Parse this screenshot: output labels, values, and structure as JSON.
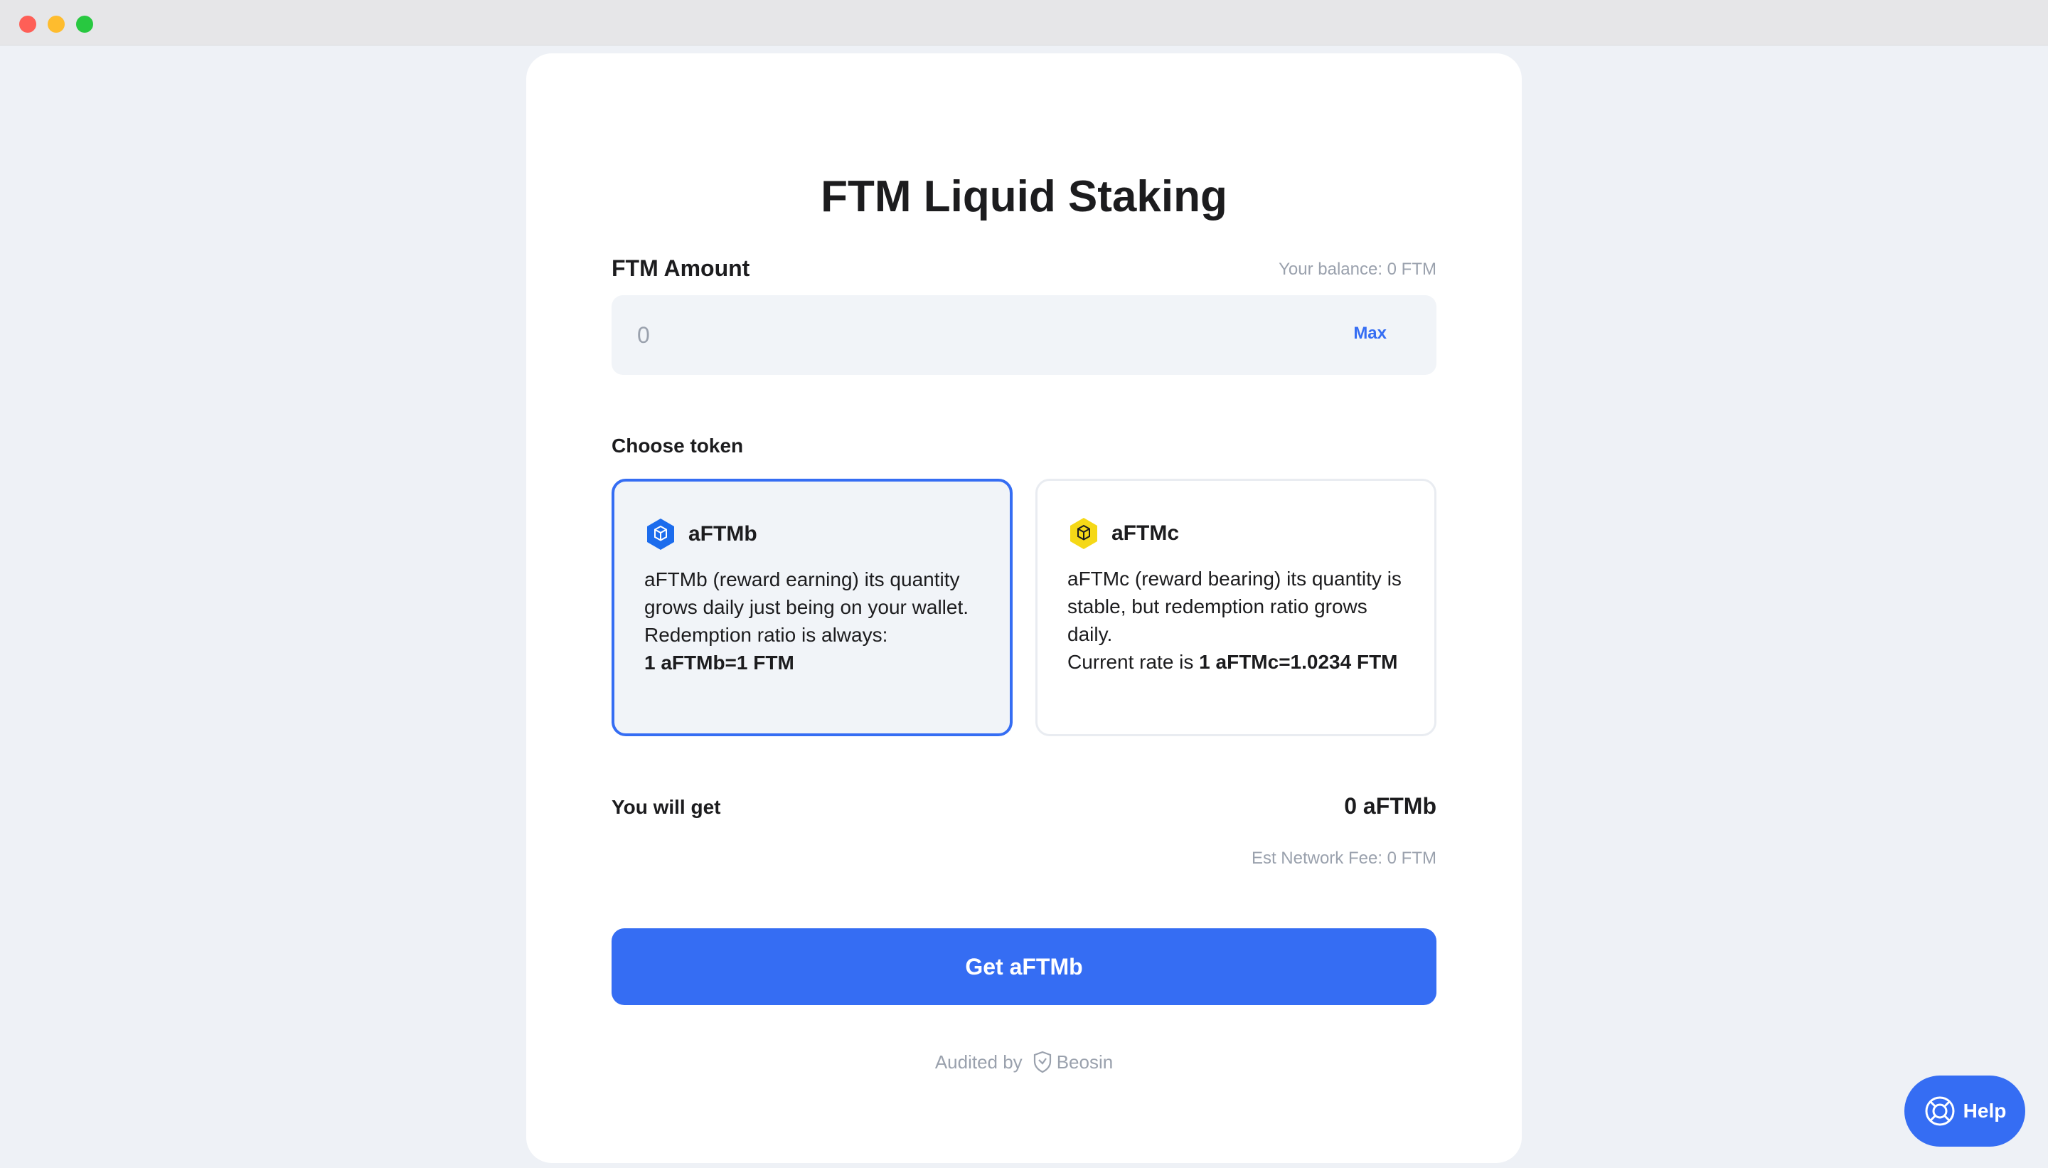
{
  "window": {
    "controls": [
      "close",
      "minimize",
      "maximize"
    ]
  },
  "page": {
    "title": "FTM Liquid Staking"
  },
  "amount": {
    "label": "FTM Amount",
    "balance": "Your balance: 0 FTM",
    "placeholder": "0",
    "value": "",
    "max_label": "Max"
  },
  "tokens": {
    "label": "Choose token",
    "items": [
      {
        "name": "aFTMb",
        "selected": true,
        "icon": "aftmb-hexagon-icon",
        "icon_color": "#1c6ced",
        "desc_plain": "aFTMb (reward earning) its quantity grows daily just being on your wallet. Redemption ratio is always: ",
        "desc_bold": "1 aFTMb=1 FTM"
      },
      {
        "name": "aFTMc",
        "selected": false,
        "icon": "aftmc-hexagon-icon",
        "icon_color": "#f5d817",
        "desc_plain": "aFTMc (reward bearing) its quantity is stable, but redemption ratio grows daily.",
        "desc_plain2": "Current rate is ",
        "desc_bold": "1 aFTMc=1.0234 FTM"
      }
    ]
  },
  "summary": {
    "get_label": "You will get",
    "get_value": "0 aFTMb",
    "fee": "Est Network Fee: 0 FTM"
  },
  "submit": {
    "label": "Get aFTMb"
  },
  "audit": {
    "prefix": "Audited by",
    "auditor": "Beosin"
  },
  "help": {
    "label": "Help"
  },
  "colors": {
    "accent": "#356df3",
    "background": "#eef1f6",
    "muted_text": "#9aa1ad"
  }
}
